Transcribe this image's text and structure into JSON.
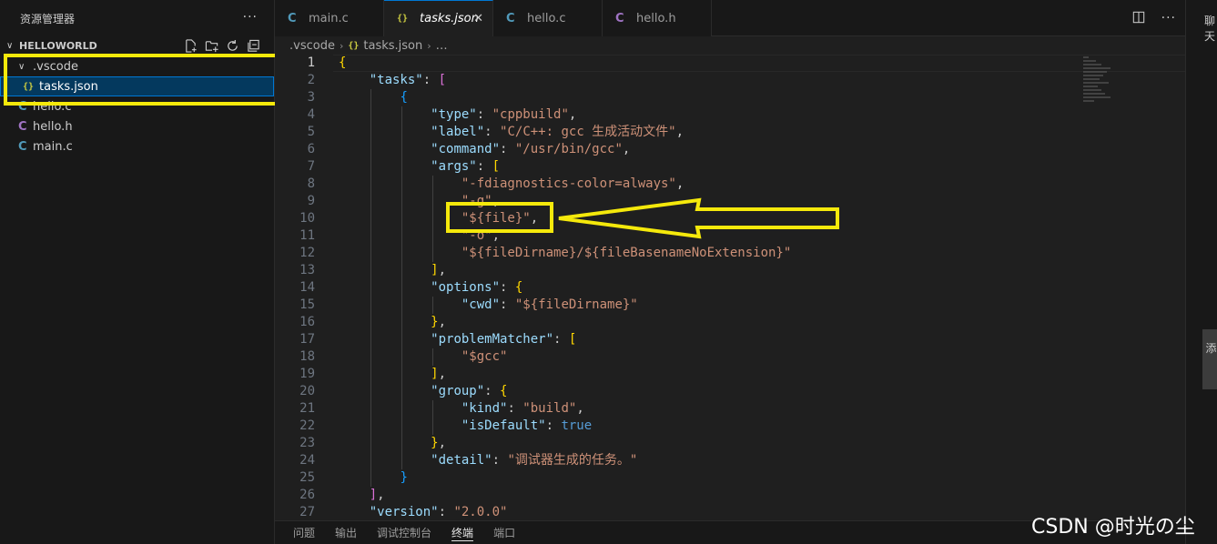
{
  "sidebar": {
    "title": "资源管理器",
    "more": "···",
    "project": "HELLOWORLD",
    "tree": [
      {
        "label": ".vscode",
        "type": "folder"
      },
      {
        "label": "tasks.json",
        "type": "json",
        "icon": "{}"
      },
      {
        "label": "hello.c",
        "type": "c",
        "icon": "C"
      },
      {
        "label": "hello.h",
        "type": "h",
        "icon": "C"
      },
      {
        "label": "main.c",
        "type": "c",
        "icon": "C"
      }
    ]
  },
  "tabs": [
    {
      "label": "main.c",
      "icon": "C"
    },
    {
      "label": "tasks.json",
      "icon": "{}",
      "active": true,
      "close": "✕"
    },
    {
      "label": "hello.c",
      "icon": "C"
    },
    {
      "label": "hello.h",
      "icon": "C"
    }
  ],
  "breadcrumb": {
    "folder": ".vscode",
    "file": "tasks.json",
    "more": "…",
    "icon": "{}"
  },
  "code_lines": [
    [
      [
        "b1",
        "{"
      ]
    ],
    [
      [
        "p",
        "    "
      ],
      [
        "k",
        "\"tasks\""
      ],
      [
        "p",
        ": "
      ],
      [
        "b2",
        "["
      ]
    ],
    [
      [
        "p",
        "        "
      ],
      [
        "b3",
        "{"
      ]
    ],
    [
      [
        "p",
        "            "
      ],
      [
        "k",
        "\"type\""
      ],
      [
        "p",
        ": "
      ],
      [
        "s",
        "\"cppbuild\""
      ],
      [
        "p",
        ","
      ]
    ],
    [
      [
        "p",
        "            "
      ],
      [
        "k",
        "\"label\""
      ],
      [
        "p",
        ": "
      ],
      [
        "s",
        "\"C/C++: gcc 生成活动文件\""
      ],
      [
        "p",
        ","
      ]
    ],
    [
      [
        "p",
        "            "
      ],
      [
        "k",
        "\"command\""
      ],
      [
        "p",
        ": "
      ],
      [
        "s",
        "\"/usr/bin/gcc\""
      ],
      [
        "p",
        ","
      ]
    ],
    [
      [
        "p",
        "            "
      ],
      [
        "k",
        "\"args\""
      ],
      [
        "p",
        ": "
      ],
      [
        "b1",
        "["
      ]
    ],
    [
      [
        "p",
        "                "
      ],
      [
        "s",
        "\"-fdiagnostics-color=always\""
      ],
      [
        "p",
        ","
      ]
    ],
    [
      [
        "p",
        "                "
      ],
      [
        "s",
        "\"-g\""
      ],
      [
        "p",
        ","
      ]
    ],
    [
      [
        "p",
        "                "
      ],
      [
        "s",
        "\"${file}\""
      ],
      [
        "p",
        ","
      ]
    ],
    [
      [
        "p",
        "                "
      ],
      [
        "s",
        "\"-o\""
      ],
      [
        "p",
        ","
      ]
    ],
    [
      [
        "p",
        "                "
      ],
      [
        "s",
        "\"${fileDirname}/${fileBasenameNoExtension}\""
      ]
    ],
    [
      [
        "p",
        "            "
      ],
      [
        "b1",
        "]"
      ],
      [
        "p",
        ","
      ]
    ],
    [
      [
        "p",
        "            "
      ],
      [
        "k",
        "\"options\""
      ],
      [
        "p",
        ": "
      ],
      [
        "b1",
        "{"
      ]
    ],
    [
      [
        "p",
        "                "
      ],
      [
        "k",
        "\"cwd\""
      ],
      [
        "p",
        ": "
      ],
      [
        "s",
        "\"${fileDirname}\""
      ]
    ],
    [
      [
        "p",
        "            "
      ],
      [
        "b1",
        "}"
      ],
      [
        "p",
        ","
      ]
    ],
    [
      [
        "p",
        "            "
      ],
      [
        "k",
        "\"problemMatcher\""
      ],
      [
        "p",
        ": "
      ],
      [
        "b1",
        "["
      ]
    ],
    [
      [
        "p",
        "                "
      ],
      [
        "s",
        "\"$gcc\""
      ]
    ],
    [
      [
        "p",
        "            "
      ],
      [
        "b1",
        "]"
      ],
      [
        "p",
        ","
      ]
    ],
    [
      [
        "p",
        "            "
      ],
      [
        "k",
        "\"group\""
      ],
      [
        "p",
        ": "
      ],
      [
        "b1",
        "{"
      ]
    ],
    [
      [
        "p",
        "                "
      ],
      [
        "k",
        "\"kind\""
      ],
      [
        "p",
        ": "
      ],
      [
        "s",
        "\"build\""
      ],
      [
        "p",
        ","
      ]
    ],
    [
      [
        "p",
        "                "
      ],
      [
        "k",
        "\"isDefault\""
      ],
      [
        "p",
        ": "
      ],
      [
        "kw",
        "true"
      ]
    ],
    [
      [
        "p",
        "            "
      ],
      [
        "b1",
        "}"
      ],
      [
        "p",
        ","
      ]
    ],
    [
      [
        "p",
        "            "
      ],
      [
        "k",
        "\"detail\""
      ],
      [
        "p",
        ": "
      ],
      [
        "s",
        "\"调试器生成的任务。\""
      ]
    ],
    [
      [
        "p",
        "        "
      ],
      [
        "b3",
        "}"
      ]
    ],
    [
      [
        "p",
        "    "
      ],
      [
        "b2",
        "]"
      ],
      [
        "p",
        ","
      ]
    ],
    [
      [
        "p",
        "    "
      ],
      [
        "k",
        "\"version\""
      ],
      [
        "p",
        ": "
      ],
      [
        "s",
        "\"2.0.0\""
      ]
    ]
  ],
  "panel_tabs": [
    "问题",
    "输出",
    "调试控制台",
    "终端",
    "端口"
  ],
  "panel_active": "终端",
  "right": {
    "chat": "聊天",
    "side": "添"
  },
  "watermark": "CSDN @时光の尘",
  "colors": {
    "highlight": "#f5e90b",
    "accent": "#0078d4"
  }
}
